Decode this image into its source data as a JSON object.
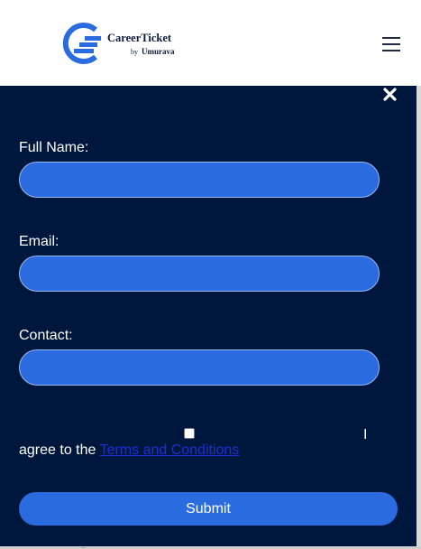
{
  "brand": {
    "name": "CareerTicket",
    "by_word": "by",
    "by_name": "Umurava",
    "accent_color": "#2a6be0",
    "dark_color": "#00173d"
  },
  "header": {
    "menu_icon": "hamburger-menu-icon"
  },
  "modal": {
    "close_icon": "close-x-icon",
    "fields": [
      {
        "label": "Full Name:",
        "value": "",
        "placeholder": ""
      },
      {
        "label": "Email:",
        "value": "",
        "placeholder": ""
      },
      {
        "label": "Contact:",
        "value": "",
        "placeholder": ""
      }
    ],
    "consent": {
      "checked": false,
      "pronoun": "I",
      "text": "agree to the",
      "link_text": "Terms and Conditions"
    },
    "submit_label": "Submit"
  },
  "footer_peek": "..."
}
